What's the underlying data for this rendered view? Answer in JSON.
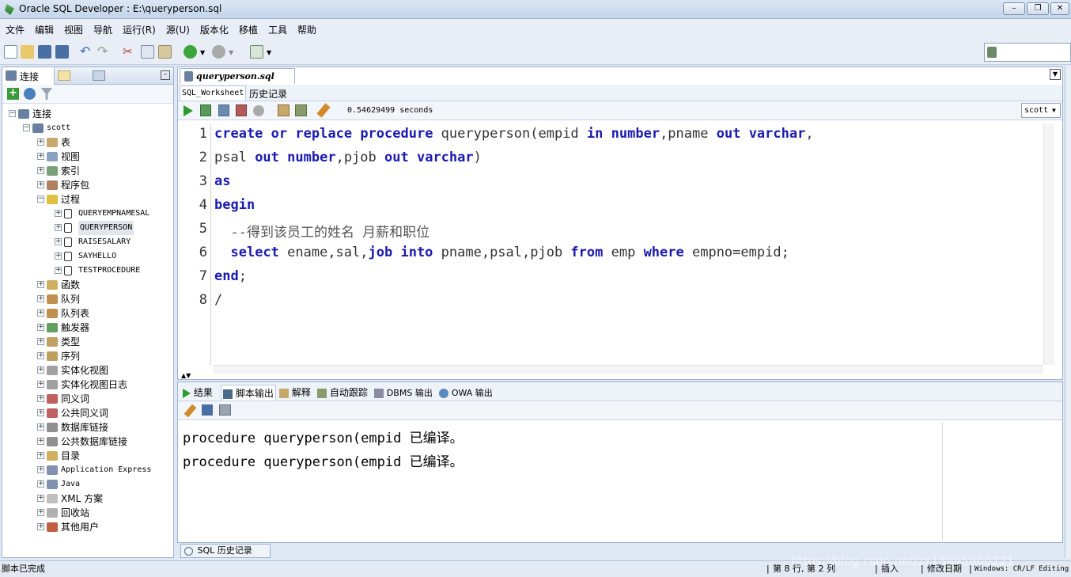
{
  "window": {
    "title": "Oracle SQL Developer : E:\\queryperson.sql"
  },
  "menu": [
    "文件",
    "编辑",
    "视图",
    "导航",
    "运行(R)",
    "源(U)",
    "版本化",
    "移植",
    "工具",
    "帮助"
  ],
  "left_panel": {
    "tab_label": "连接",
    "tree": [
      {
        "label": "连接",
        "level": 0,
        "mono": false
      },
      {
        "label": "scott",
        "level": 1,
        "mono": true
      },
      {
        "label": "表",
        "level": 2,
        "mono": false,
        "color": "#c8a86a"
      },
      {
        "label": "视图",
        "level": 2,
        "mono": false,
        "color": "#8aa0c0"
      },
      {
        "label": "索引",
        "level": 2,
        "mono": false,
        "color": "#7aa07a"
      },
      {
        "label": "程序包",
        "level": 2,
        "mono": false,
        "color": "#b08060"
      },
      {
        "label": "过程",
        "level": 2,
        "mono": false,
        "expanded": true,
        "color": "#e0c040"
      },
      {
        "label": "QUERYEMPNAMESAL",
        "level": 3,
        "mono": true
      },
      {
        "label": "QUERYPERSON",
        "level": 3,
        "mono": true,
        "selected": true
      },
      {
        "label": "RAISESALARY",
        "level": 3,
        "mono": true
      },
      {
        "label": "SAYHELLO",
        "level": 3,
        "mono": true
      },
      {
        "label": "TESTPROCEDURE",
        "level": 3,
        "mono": true
      },
      {
        "label": "函数",
        "level": 2,
        "mono": false,
        "color": "#d0b060"
      },
      {
        "label": "队列",
        "level": 2,
        "mono": false,
        "color": "#c09050"
      },
      {
        "label": "队列表",
        "level": 2,
        "mono": false,
        "color": "#c09050"
      },
      {
        "label": "触发器",
        "level": 2,
        "mono": false,
        "color": "#60a060"
      },
      {
        "label": "类型",
        "level": 2,
        "mono": false,
        "color": "#c0a060"
      },
      {
        "label": "序列",
        "level": 2,
        "mono": false,
        "color": "#c0a060"
      },
      {
        "label": "实体化视图",
        "level": 2,
        "mono": false,
        "color": "#a0a0a0"
      },
      {
        "label": "实体化视图日志",
        "level": 2,
        "mono": false,
        "color": "#a0a0a0"
      },
      {
        "label": "同义词",
        "level": 2,
        "mono": false,
        "color": "#c06060"
      },
      {
        "label": "公共同义词",
        "level": 2,
        "mono": false,
        "color": "#c06060"
      },
      {
        "label": "数据库链接",
        "level": 2,
        "mono": false,
        "color": "#909090"
      },
      {
        "label": "公共数据库链接",
        "level": 2,
        "mono": false,
        "color": "#909090"
      },
      {
        "label": "目录",
        "level": 2,
        "mono": false,
        "color": "#d0b060"
      },
      {
        "label": "Application Express",
        "level": 2,
        "mono": true,
        "color": "#8090b0"
      },
      {
        "label": "Java",
        "level": 2,
        "mono": true,
        "color": "#8090b0"
      },
      {
        "label": "XML 方案",
        "level": 2,
        "mono": false,
        "color": "#c0c0c0"
      },
      {
        "label": "回收站",
        "level": 2,
        "mono": false,
        "color": "#b0b0b0"
      },
      {
        "label": "其他用户",
        "level": 2,
        "mono": false,
        "color": "#c06040"
      }
    ]
  },
  "editor": {
    "doc_tab": "queryperson.sql",
    "subtabs": [
      "SQL_Worksheet",
      "历史记录"
    ],
    "exec_time": "0.54629499 seconds",
    "connection": "scott",
    "line_numbers": [
      "1",
      "2",
      "3",
      "4",
      "5",
      "6",
      "7",
      "8"
    ],
    "lines": [
      [
        [
          "k",
          "create"
        ],
        [
          "t",
          " "
        ],
        [
          "k",
          "or"
        ],
        [
          "t",
          " "
        ],
        [
          "k",
          "replace"
        ],
        [
          "t",
          " "
        ],
        [
          "k",
          "procedure"
        ],
        [
          "t",
          " queryperson(empid "
        ],
        [
          "k",
          "in"
        ],
        [
          "t",
          " "
        ],
        [
          "k",
          "number"
        ],
        [
          "t",
          ",pname "
        ],
        [
          "k",
          "out"
        ],
        [
          "t",
          " "
        ],
        [
          "k",
          "varchar"
        ],
        [
          "t",
          ","
        ]
      ],
      [
        [
          "t",
          "psal "
        ],
        [
          "k",
          "out"
        ],
        [
          "t",
          " "
        ],
        [
          "k",
          "number"
        ],
        [
          "t",
          ",pjob "
        ],
        [
          "k",
          "out"
        ],
        [
          "t",
          " "
        ],
        [
          "k",
          "varchar"
        ],
        [
          "t",
          ")"
        ]
      ],
      [
        [
          "k",
          "as"
        ]
      ],
      [
        [
          "k",
          "begin"
        ]
      ],
      [
        [
          "c",
          "  --得到该员工的姓名 月薪和职位"
        ]
      ],
      [
        [
          "t",
          "  "
        ],
        [
          "k",
          "select"
        ],
        [
          "t",
          " ename,sal,"
        ],
        [
          "k",
          "job"
        ],
        [
          "t",
          " "
        ],
        [
          "k",
          "into"
        ],
        [
          "t",
          " pname,psal,pjob "
        ],
        [
          "k",
          "from"
        ],
        [
          "t",
          " emp "
        ],
        [
          "k",
          "where"
        ],
        [
          "t",
          " empno=empid;"
        ]
      ],
      [
        [
          "k",
          "end"
        ],
        [
          "t",
          ";"
        ]
      ],
      [
        [
          "t",
          "/"
        ]
      ]
    ]
  },
  "output": {
    "tabs": [
      "结果",
      "脚本输出",
      "解释",
      "自动跟踪",
      "DBMS 输出",
      "OWA 输出"
    ],
    "lines": [
      "procedure queryperson(empid 已编译。",
      "procedure queryperson(empid 已编译。"
    ]
  },
  "bottom_tab": "SQL 历史记录",
  "status": {
    "left": "脚本已完成",
    "position": "第 8 行, 第 2 列",
    "mode": "插入",
    "modified": "修改日期",
    "encoding": "Windows: CR/LF Editing",
    "watermark": "https://blog.csdn.net/zx13995900221"
  }
}
